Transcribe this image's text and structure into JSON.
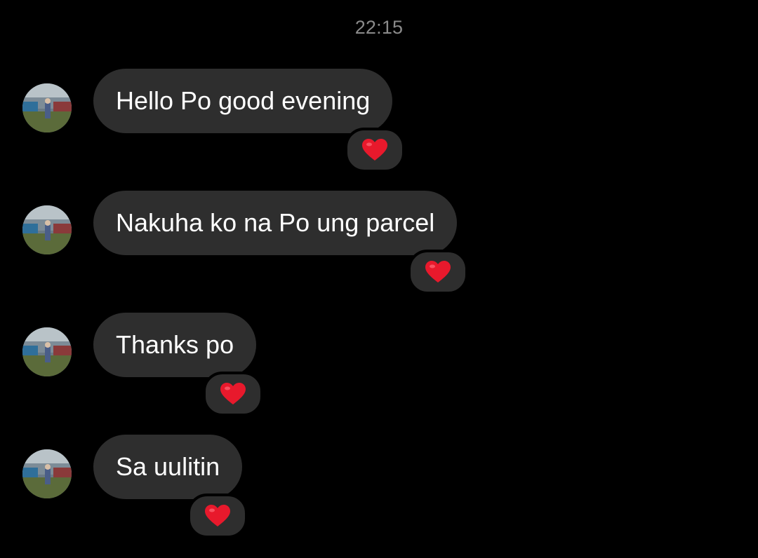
{
  "header": {
    "timestamp": "22:15"
  },
  "messages": [
    {
      "text": "Hello Po good evening",
      "reaction": "heart-icon"
    },
    {
      "text": "Nakuha ko na Po ung parcel",
      "reaction": "heart-icon"
    },
    {
      "text": "Thanks po",
      "reaction": "heart-icon"
    },
    {
      "text": "Sa uulitin",
      "reaction": "heart-icon"
    }
  ],
  "colors": {
    "background": "#000000",
    "bubble": "#2e2e2e",
    "text": "#ffffff",
    "timestamp": "#8a8a8a",
    "heart": "#e8192c"
  }
}
